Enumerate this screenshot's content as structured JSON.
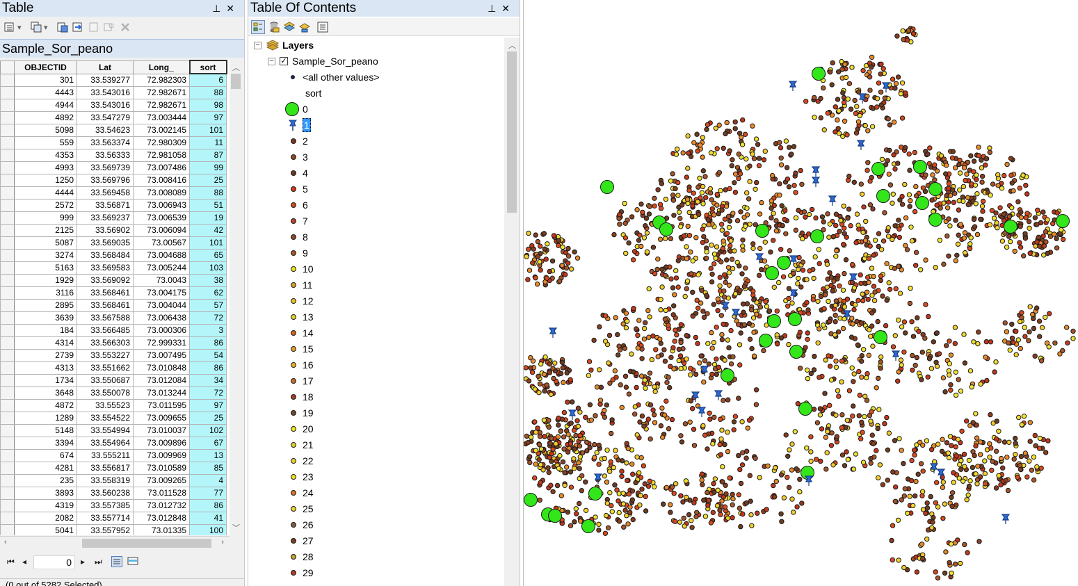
{
  "table_pane": {
    "title": "Table",
    "tab_name": "Sample_Sor_peano",
    "columns": [
      "OBJECTID",
      "Lat",
      "Long_",
      "sort"
    ],
    "rows": [
      [
        "301",
        "33.539277",
        "72.982303",
        "6"
      ],
      [
        "4443",
        "33.543016",
        "72.982671",
        "88"
      ],
      [
        "4944",
        "33.543016",
        "72.982671",
        "98"
      ],
      [
        "4892",
        "33.547279",
        "73.003444",
        "97"
      ],
      [
        "5098",
        "33.54623",
        "73.002145",
        "101"
      ],
      [
        "559",
        "33.563374",
        "72.980309",
        "11"
      ],
      [
        "4353",
        "33.56333",
        "72.981058",
        "87"
      ],
      [
        "4993",
        "33.569739",
        "73.007486",
        "99"
      ],
      [
        "1250",
        "33.569796",
        "73.008416",
        "25"
      ],
      [
        "4444",
        "33.569458",
        "73.008089",
        "88"
      ],
      [
        "2572",
        "33.56871",
        "73.006943",
        "51"
      ],
      [
        "999",
        "33.569237",
        "73.006539",
        "19"
      ],
      [
        "2125",
        "33.56902",
        "73.006094",
        "42"
      ],
      [
        "5087",
        "33.569035",
        "73.00567",
        "101"
      ],
      [
        "3274",
        "33.568484",
        "73.004688",
        "65"
      ],
      [
        "5163",
        "33.569583",
        "73.005244",
        "103"
      ],
      [
        "1929",
        "33.569092",
        "73.0043",
        "38"
      ],
      [
        "3116",
        "33.568461",
        "73.004175",
        "62"
      ],
      [
        "2895",
        "33.568461",
        "73.004044",
        "57"
      ],
      [
        "3639",
        "33.567588",
        "73.006438",
        "72"
      ],
      [
        "184",
        "33.566485",
        "73.000306",
        "3"
      ],
      [
        "4314",
        "33.566303",
        "72.999331",
        "86"
      ],
      [
        "2739",
        "33.553227",
        "73.007495",
        "54"
      ],
      [
        "4313",
        "33.551662",
        "73.010848",
        "86"
      ],
      [
        "1734",
        "33.550687",
        "73.012084",
        "34"
      ],
      [
        "3648",
        "33.550078",
        "73.013244",
        "72"
      ],
      [
        "4872",
        "33.55523",
        "73.011595",
        "97"
      ],
      [
        "1289",
        "33.554522",
        "73.009655",
        "25"
      ],
      [
        "5148",
        "33.554994",
        "73.010037",
        "102"
      ],
      [
        "3394",
        "33.554964",
        "73.009896",
        "67"
      ],
      [
        "674",
        "33.555211",
        "73.009969",
        "13"
      ],
      [
        "4281",
        "33.556817",
        "73.010589",
        "85"
      ],
      [
        "235",
        "33.558319",
        "73.009265",
        "4"
      ],
      [
        "3893",
        "33.560238",
        "73.011528",
        "77"
      ],
      [
        "4319",
        "33.557385",
        "73.012732",
        "86"
      ],
      [
        "2082",
        "33.557714",
        "73.012848",
        "41"
      ],
      [
        "5041",
        "33.557952",
        "73.01335",
        "100"
      ]
    ],
    "record_number": "0",
    "status_text": "(0 out of 5282 Selected)"
  },
  "toc_pane": {
    "title": "Table Of Contents",
    "root_label": "Layers",
    "layer_name": "Sample_Sor_peano",
    "layer_checked": true,
    "other_values_label": "<all other values>",
    "field_label": "sort",
    "legend_items": [
      {
        "label": "0",
        "symbol": "large-green-circle",
        "color": "#33e61a"
      },
      {
        "label": "1",
        "symbol": "blue-pushpin",
        "color": "#2a6bd6",
        "selected": true
      },
      {
        "label": "2",
        "symbol": "circle",
        "color": "#7a3a1e"
      },
      {
        "label": "3",
        "symbol": "circle",
        "color": "#8a4a22"
      },
      {
        "label": "4",
        "symbol": "circle",
        "color": "#6b3a20"
      },
      {
        "label": "5",
        "symbol": "circle",
        "color": "#d23a1e"
      },
      {
        "label": "6",
        "symbol": "circle",
        "color": "#c8501e"
      },
      {
        "label": "7",
        "symbol": "circle",
        "color": "#b8462a"
      },
      {
        "label": "8",
        "symbol": "circle",
        "color": "#8c4a28"
      },
      {
        "label": "9",
        "symbol": "circle",
        "color": "#a05a2a"
      },
      {
        "label": "10",
        "symbol": "circle",
        "color": "#f0e21e"
      },
      {
        "label": "11",
        "symbol": "circle",
        "color": "#d8a028"
      },
      {
        "label": "12",
        "symbol": "circle",
        "color": "#e8c028"
      },
      {
        "label": "13",
        "symbol": "circle",
        "color": "#e0d02a"
      },
      {
        "label": "14",
        "symbol": "circle",
        "color": "#d06420"
      },
      {
        "label": "15",
        "symbol": "circle",
        "color": "#e0a030"
      },
      {
        "label": "16",
        "symbol": "circle",
        "color": "#e8b030"
      },
      {
        "label": "17",
        "symbol": "circle",
        "color": "#c07030"
      },
      {
        "label": "18",
        "symbol": "circle",
        "color": "#a0402a"
      },
      {
        "label": "19",
        "symbol": "circle",
        "color": "#6e4a30"
      },
      {
        "label": "20",
        "symbol": "circle",
        "color": "#f0e41e"
      },
      {
        "label": "21",
        "symbol": "circle",
        "color": "#d8d030"
      },
      {
        "label": "22",
        "symbol": "circle",
        "color": "#e8d028"
      },
      {
        "label": "23",
        "symbol": "circle",
        "color": "#f0e020"
      },
      {
        "label": "24",
        "symbol": "circle",
        "color": "#d87028"
      },
      {
        "label": "25",
        "symbol": "circle",
        "color": "#e8d030"
      },
      {
        "label": "26",
        "symbol": "circle",
        "color": "#806040"
      },
      {
        "label": "27",
        "symbol": "circle",
        "color": "#7a4020"
      },
      {
        "label": "28",
        "symbol": "circle",
        "color": "#c0a030"
      },
      {
        "label": "29",
        "symbol": "circle",
        "color": "#b03a28"
      }
    ]
  },
  "map_pane": {
    "point_colors": [
      "#d94a1e",
      "#f2cd2a",
      "#8a3d20",
      "#e88a2a",
      "#a6542a",
      "#f0e030",
      "#c0381c",
      "#6e3c22"
    ],
    "highlight_color": "#33e61a",
    "pin_color": "#2a6bd6"
  }
}
